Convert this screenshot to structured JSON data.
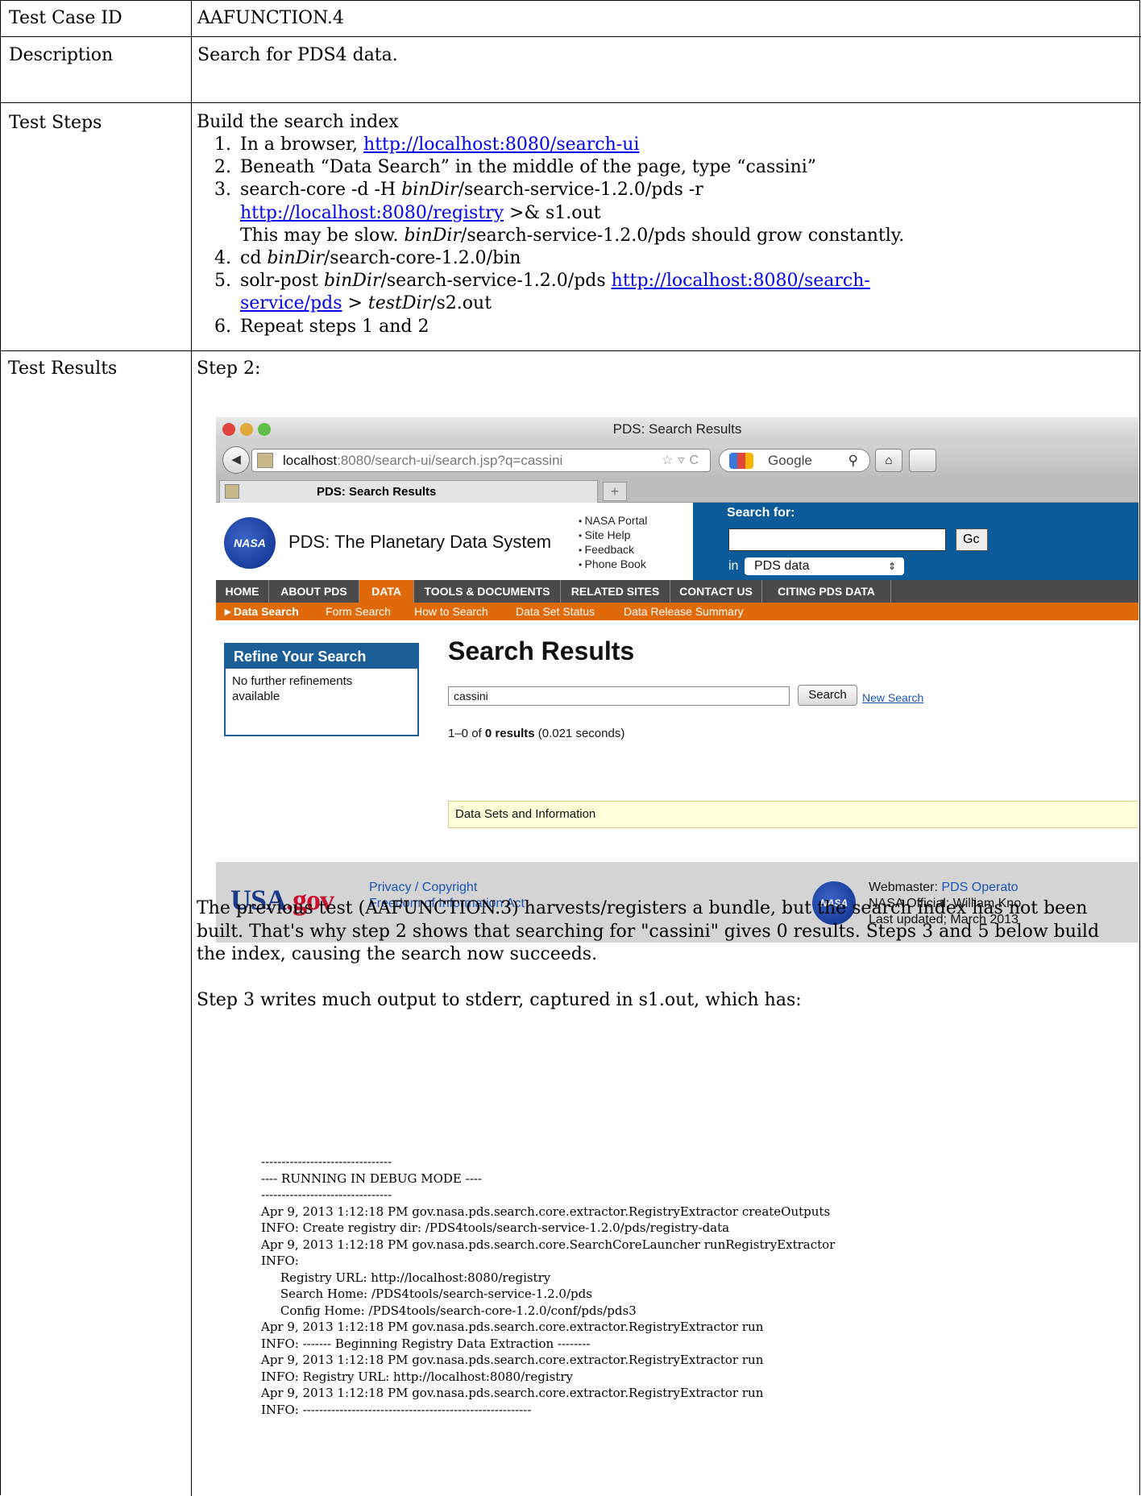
{
  "row1": {
    "label": "Test Case ID",
    "value": "AAFUNCTION.4"
  },
  "row2": {
    "label": "Description",
    "value": "Search for PDS4 data."
  },
  "row3": {
    "label": "Test Steps",
    "intro": "Build the search index",
    "steps": [
      {
        "num": "1.",
        "text": "In a browser, ",
        "link": "http://localhost:8080/search-ui"
      },
      {
        "num": "2.",
        "text": "Beneath “Data Search” in the middle of the page, type “cassini”"
      },
      {
        "num": "3.",
        "text_a": "search-core -d -H ",
        "italic": "binDir",
        "text_b": "/search-service-1.2.0/pds -r",
        "link": "http://localhost:8080/registry",
        "text_c": " >& s1.out",
        "note_italic": "binDir",
        "note_a": "This may be slow. ",
        "note_b": "/search-service-1.2.0/pds should grow constantly."
      },
      {
        "num": "4.",
        "text_a": "cd ",
        "italic": "binDir",
        "text_b": "/search-core-1.2.0/bin"
      },
      {
        "num": "5.",
        "text_a": "solr-post ",
        "italic": "binDir",
        "text_b": "/search-service-1.2.0/pds ",
        "link_a": "http://localhost:8080/search-",
        "link_b": "service/pds",
        "text_c": " > ",
        "italic2": "testDir",
        "text_d": "/s2.out"
      },
      {
        "num": "6.",
        "text": "Repeat steps 1 and 2"
      }
    ]
  },
  "row4": {
    "label": "Test Results",
    "step_label": "Step 2:"
  },
  "browser": {
    "window_title": "PDS: Search Results",
    "url_host": "localhost",
    "url_rest": ":8080/search-ui/search.jsp?q=cassini",
    "search_engine": "Google",
    "tab_title": "PDS: Search Results",
    "new_tab": "+",
    "site_title": "PDS: The Planetary Data System",
    "nasa_logo_text": "NASA",
    "quick_links": [
      "NASA Portal",
      "Site Help",
      "Feedback",
      "Phone Book"
    ],
    "search_for": "Search for:",
    "go": "Gc",
    "in_label": "in",
    "scope_select": "PDS data",
    "main_nav": [
      "HOME",
      "ABOUT PDS",
      "DATA",
      "TOOLS & DOCUMENTS",
      "RELATED SITES",
      "CONTACT US",
      "CITING PDS DATA"
    ],
    "active_nav": "DATA",
    "sub_nav": [
      "►Data Search",
      "Form Search",
      "How to Search",
      "Data Set Status",
      "Data Release Summary"
    ],
    "refine_title": "Refine Your Search",
    "refine_text": "No further refinements available",
    "results_title": "Search Results",
    "query": "cassini",
    "search_button": "Search",
    "new_search": "New Search",
    "count_prefix": "1–0 of ",
    "count_bold": "0 results",
    "count_suffix": " (0.021 seconds)",
    "datasets_box": "Data Sets and Information",
    "footer": {
      "usa_gov": "USA",
      "usa_gov_suffix": ".gov",
      "privacy": "Privacy / Copyright",
      "foia": "Freedom of Information Act",
      "webmaster_label": "Webmaster: ",
      "webmaster_link": "PDS Operato",
      "official": "NASA Official: William Kno",
      "updated": "Last updated; March 2013"
    }
  },
  "explanation": [
    "The previous test (AAFUNCTION.3) harvests/registers a bundle, but the search index has not been built. That's why step 2 shows that searching for \"cassini\" gives 0 results. Steps 3 and 5 below build the index, causing the search now succeeds.",
    "Step 3 writes much output to stderr, captured in s1.out, which has:"
  ],
  "log_lines": [
    "--------------------------------",
    "---- RUNNING IN DEBUG MODE ----",
    "--------------------------------",
    "Apr 9, 2013 1:12:18 PM gov.nasa.pds.search.core.extractor.RegistryExtractor createOutputs",
    "INFO: Create registry dir: /PDS4tools/search-service-1.2.0/pds/registry-data",
    "Apr 9, 2013 1:12:18 PM gov.nasa.pds.search.core.SearchCoreLauncher runRegistryExtractor",
    "INFO:",
    "     Registry URL: http://localhost:8080/registry",
    "     Search Home: /PDS4tools/search-service-1.2.0/pds",
    "     Config Home: /PDS4tools/search-core-1.2.0/conf/pds/pds3",
    "Apr 9, 2013 1:12:18 PM gov.nasa.pds.search.core.extractor.RegistryExtractor run",
    "INFO: ------- Beginning Registry Data Extraction --------",
    "Apr 9, 2013 1:12:18 PM gov.nasa.pds.search.core.extractor.RegistryExtractor run",
    "INFO: Registry URL: http://localhost:8080/registry",
    "Apr 9, 2013 1:12:18 PM gov.nasa.pds.search.core.extractor.RegistryExtractor run",
    "INFO: --------------------------------------------------------"
  ]
}
